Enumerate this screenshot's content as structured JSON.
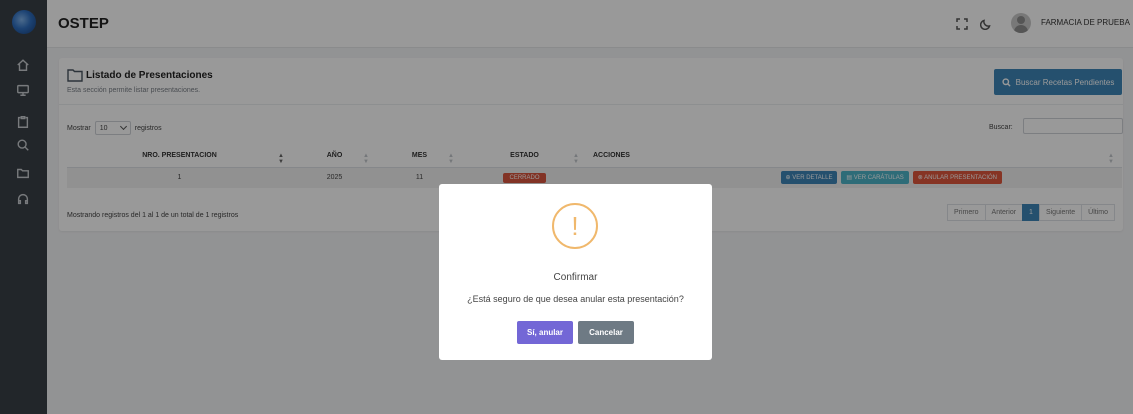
{
  "app": {
    "title": "OSTEP",
    "user_name": "FARMACIA DE PRUEBA"
  },
  "sidebar": {
    "items": [
      "home-icon",
      "monitor-icon",
      "clipboard-icon",
      "search-icon",
      "folder-icon",
      "headset-icon"
    ]
  },
  "card": {
    "title": "Listado de Presentaciones",
    "subtitle": "Esta sección permite listar presentaciones.",
    "search_button": "Buscar Recetas Pendientes"
  },
  "table_controls": {
    "show_label": "Mostrar",
    "page_size": "10",
    "records_label": "registros",
    "search_label": "Buscar:"
  },
  "table": {
    "headers": [
      "NRO. PRESENTACION",
      "AÑO",
      "MES",
      "ESTADO",
      "ACCIONES"
    ],
    "rows": [
      {
        "nro": "1",
        "anio": "2025",
        "mes": "11",
        "estado": "CERRADO",
        "actions": [
          "VER DETALLE",
          "VER CARÁTULAS",
          "ANULAR PRESENTACIÓN"
        ]
      }
    ]
  },
  "footer": {
    "info": "Mostrando registros del 1 al 1 de un total de 1 registros",
    "pager": [
      "Primero",
      "Anterior",
      "1",
      "Siguiente",
      "Último"
    ]
  },
  "modal": {
    "icon": "!",
    "title": "Confirmar",
    "message": "¿Está seguro de que desea anular esta presentación?",
    "confirm_label": "Sí, anular",
    "cancel_label": "Cancelar"
  },
  "colors": {
    "primary": "#3e86b8",
    "info": "#4db5c9",
    "danger": "#e0573c",
    "confirm": "#7367d6",
    "cancel": "#6e7a84",
    "warning": "#f0b86c"
  }
}
